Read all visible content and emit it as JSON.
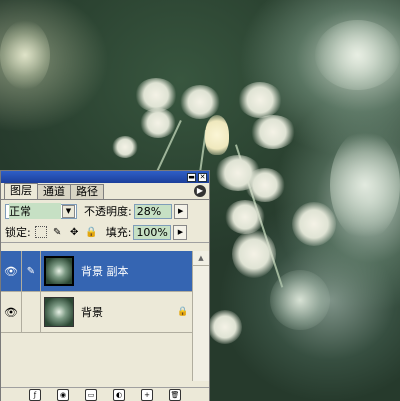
{
  "panel": {
    "tabs": [
      {
        "label": "图层"
      },
      {
        "label": "通道"
      },
      {
        "label": "路径"
      }
    ],
    "blend_mode": "正常",
    "opacity_label": "不透明度:",
    "opacity_value": "28%",
    "lock_label": "锁定:",
    "fill_label": "填充:",
    "fill_value": "100%",
    "layers": [
      {
        "name": "背景 副本",
        "selected": true,
        "visible": true
      },
      {
        "name": "背景",
        "selected": false,
        "visible": true,
        "locked": true
      }
    ],
    "icons": {
      "minimize": "minimize-icon",
      "close": "close-icon",
      "menu": "panel-menu-icon",
      "eye": "eye-icon",
      "brush": "brush-icon",
      "lock": "lock-icon"
    }
  },
  "colors": {
    "titlebar": "#1c3f9b",
    "selected_layer": "#3565b2",
    "field_highlight": "#c6e0c4"
  }
}
